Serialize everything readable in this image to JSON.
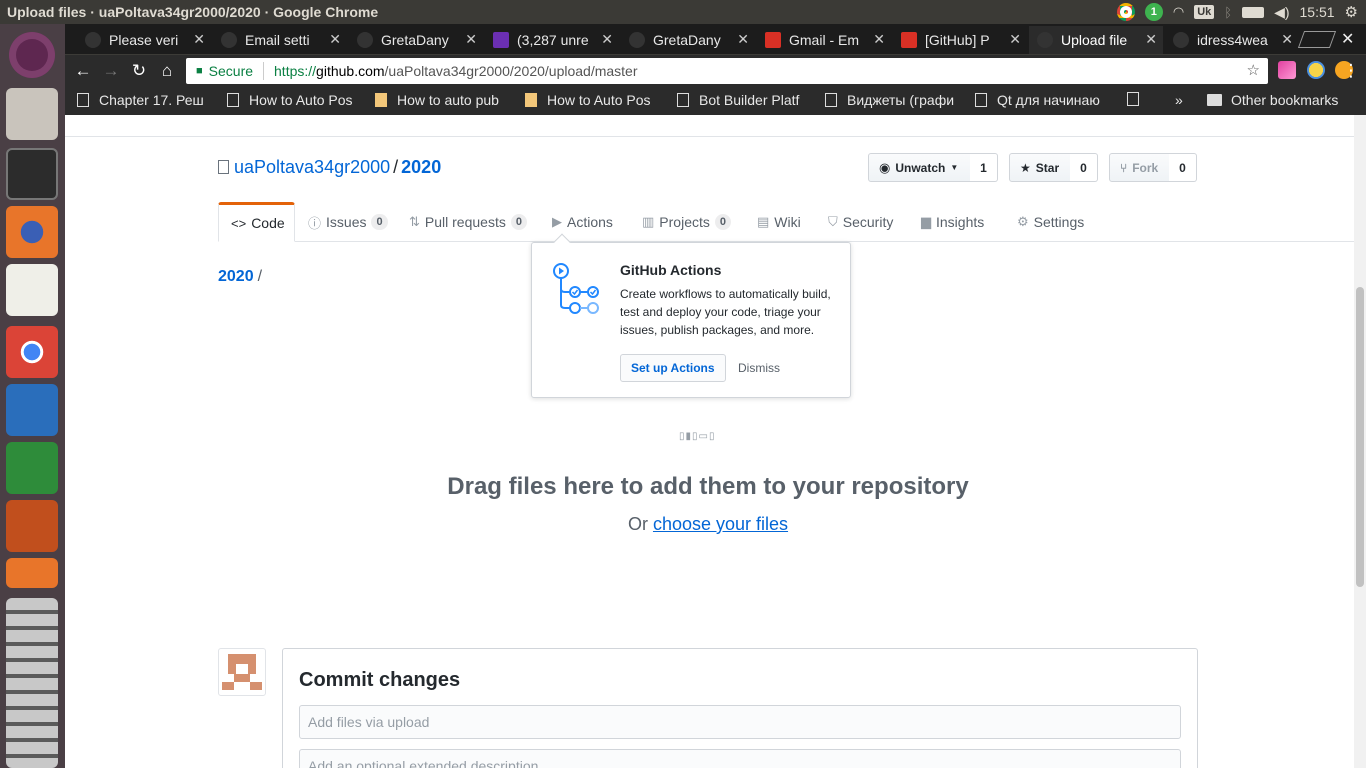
{
  "os": {
    "window_title": "Upload files · uaPoltava34gr2000/2020 · Google Chrome",
    "notification_count": "1",
    "keyboard_layout": "Uk",
    "clock": "15:51"
  },
  "tabs": [
    {
      "label": "Please veri",
      "icon": "github-icon"
    },
    {
      "label": "Email setti",
      "icon": "github-icon"
    },
    {
      "label": "GretaDany",
      "icon": "github-icon"
    },
    {
      "label": "(3,287 unre",
      "icon": "mail-icon"
    },
    {
      "label": "GretaDany",
      "icon": "github-icon"
    },
    {
      "label": "Gmail - Em",
      "icon": "gmail-icon"
    },
    {
      "label": "[GitHub] P",
      "icon": "gmail-icon"
    },
    {
      "label": "Upload file",
      "icon": "github-icon",
      "active": true
    },
    {
      "label": "idress4wea",
      "icon": "github-icon"
    }
  ],
  "address": {
    "secure_label": "Secure",
    "scheme": "https://",
    "host": "github.com",
    "path": "/uaPoltava34gr2000/2020/upload/master"
  },
  "bookmarks": [
    "Chapter 17. Реш",
    "How to Auto Pos",
    "How to auto pub",
    "How to Auto Pos",
    "Bot Builder Platf",
    "Виджеты (графи",
    "Qt для начинаю",
    "",
    "Other bookmarks"
  ],
  "repo": {
    "owner": "uaPoltava34gr2000",
    "separator": "/",
    "name": "2020",
    "unwatch_label": "Unwatch",
    "watch_count": "1",
    "star_label": "Star",
    "star_count": "0",
    "fork_label": "Fork",
    "fork_count": "0"
  },
  "nav": {
    "code": "Code",
    "issues": "Issues",
    "issues_count": "0",
    "pulls": "Pull requests",
    "pulls_count": "0",
    "actions": "Actions",
    "projects": "Projects",
    "projects_count": "0",
    "wiki": "Wiki",
    "security": "Security",
    "insights": "Insights",
    "settings": "Settings"
  },
  "breadcrumb": {
    "repo": "2020",
    "sep": "/"
  },
  "popover": {
    "title": "GitHub Actions",
    "body": "Create workflows to automatically build, test and deploy your code, triage your issues, publish packages, and more.",
    "setup_label": "Set up Actions",
    "dismiss_label": "Dismiss"
  },
  "upload": {
    "drag_text": "Drag files here to add them to your repository",
    "or_text": "Or",
    "choose_text": "choose your files"
  },
  "commit": {
    "title": "Commit changes",
    "summary_placeholder": "Add files via upload",
    "description_placeholder": "Add an optional extended description..."
  }
}
